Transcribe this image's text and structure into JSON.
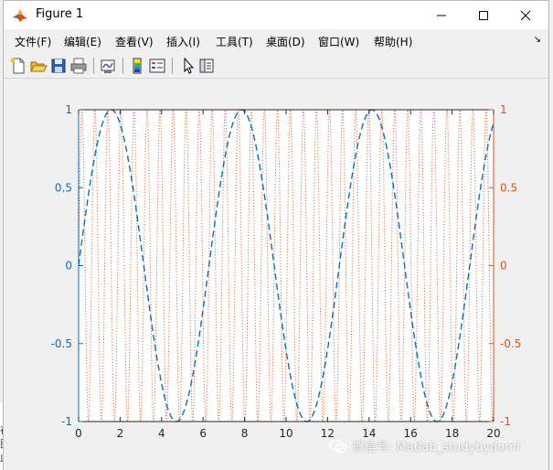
{
  "window": {
    "title": "Figure 1"
  },
  "menu": {
    "items": [
      {
        "label": "文件(F)",
        "id": "file"
      },
      {
        "label": "编辑(E)",
        "id": "edit"
      },
      {
        "label": "查看(V)",
        "id": "view"
      },
      {
        "label": "插入(I)",
        "id": "insert"
      },
      {
        "label": "工具(T)",
        "id": "tools"
      },
      {
        "label": "桌面(D)",
        "id": "desktop"
      },
      {
        "label": "窗口(W)",
        "id": "window"
      },
      {
        "label": "帮助(H)",
        "id": "help"
      }
    ],
    "dock_glyph": "↘"
  },
  "toolbar": {
    "icons": [
      "new-figure-icon",
      "open-file-icon",
      "save-icon",
      "print-icon",
      "link-plot-icon",
      "insert-colorbar-icon",
      "insert-legend-icon",
      "edit-plot-icon",
      "property-inspector-icon"
    ]
  },
  "background_text": {
    "lines": [
      "在",
      "图",
      "此时"
    ]
  },
  "chart_data": {
    "type": "line",
    "title": "",
    "xlabel": "",
    "ylabel": "",
    "xlim": [
      0,
      20
    ],
    "ylim_left": [
      -1,
      1
    ],
    "ylim_right": [
      -1,
      1
    ],
    "x_ticks": [
      "0",
      "2",
      "4",
      "6",
      "8",
      "10",
      "12",
      "14",
      "16",
      "18",
      "20"
    ],
    "y_ticks_left": [
      "1",
      "0.5",
      "0",
      "-0.5",
      "-1"
    ],
    "y_ticks_right": [
      "1",
      "0.5",
      "0",
      "-0.5",
      "-1"
    ],
    "y_tick_values": [
      1,
      0.5,
      0,
      -0.5,
      -1
    ],
    "colors": {
      "left_axis": "#0072BD",
      "right_axis": "#D95319"
    },
    "series": [
      {
        "function": "sin(x)",
        "axis": "left",
        "style": "dashed",
        "color": "#0072BD",
        "x": [
          0,
          1.5708,
          3.1416,
          4.7124,
          6.2832,
          7.854,
          9.4248,
          10.9956,
          12.5664,
          14.1372,
          15.708,
          17.2788,
          18.8496,
          20
        ],
        "y": [
          0,
          1,
          0,
          -1,
          0,
          1,
          0,
          -1,
          0,
          1,
          0,
          -1,
          0,
          0.913
        ]
      },
      {
        "function": "sin(10x)",
        "axis": "right",
        "style": "dotted",
        "color": "#D95319",
        "frequency": 10
      }
    ]
  },
  "watermark": {
    "text": "微信号: Matlab_studybydomi"
  }
}
